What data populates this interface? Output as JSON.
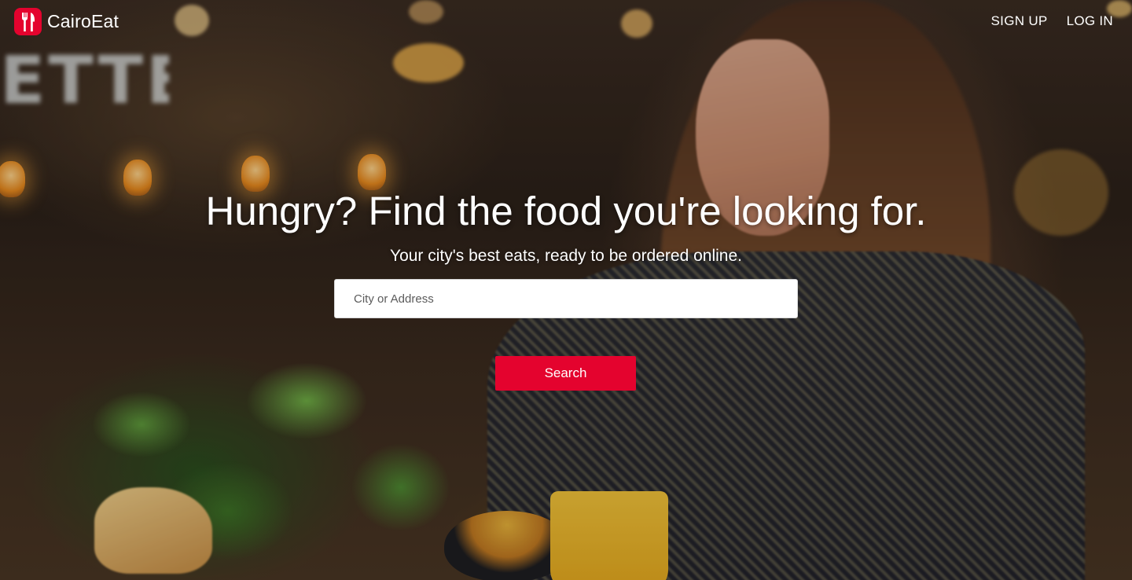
{
  "brand": {
    "name": "CairoEat",
    "logo_icon": "fork-knife-icon",
    "accent_color": "#e4032e"
  },
  "nav": {
    "signup_label": "SIGN UP",
    "login_label": "LOG IN"
  },
  "hero": {
    "headline": "Hungry? Find the food you're looking for.",
    "subheadline": "Your city's best eats, ready to be ordered online.",
    "search": {
      "value": "",
      "placeholder": "City or Address",
      "button_label": "Search"
    },
    "sign_text": "ETTE"
  }
}
